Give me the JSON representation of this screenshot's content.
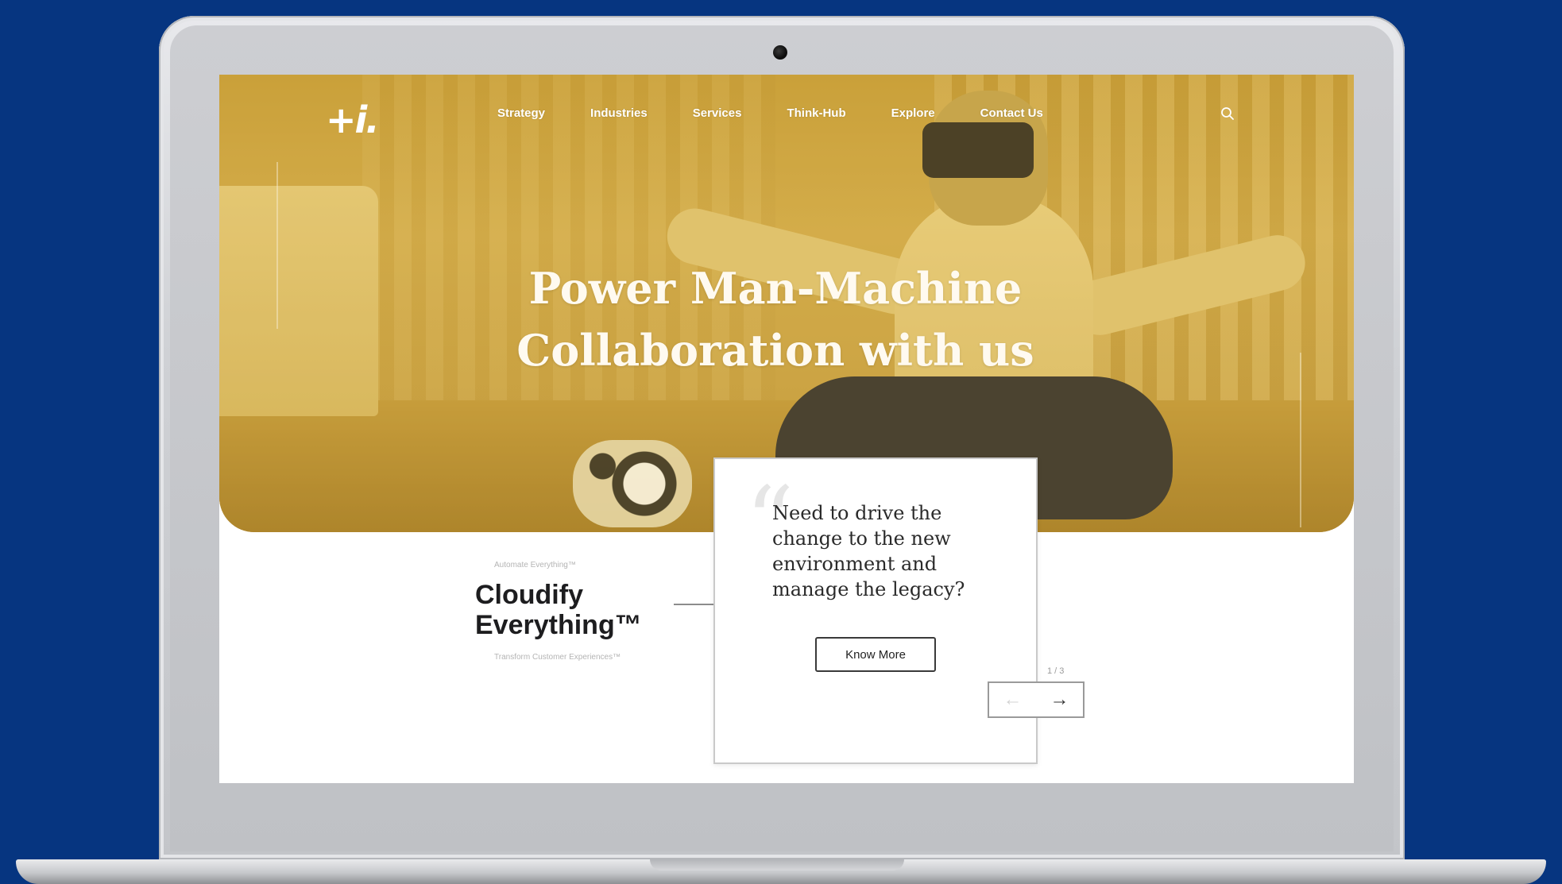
{
  "nav": {
    "logo": "+i.",
    "items": [
      {
        "label": "Strategy"
      },
      {
        "label": "Industries"
      },
      {
        "label": "Services"
      },
      {
        "label": "Think-Hub"
      },
      {
        "label": "Explore"
      },
      {
        "label": "Contact Us"
      }
    ],
    "search_icon": "search-icon"
  },
  "hero": {
    "title": "Power Man-Machine Collaboration with us"
  },
  "section": {
    "tagline_top": "Automate Everything™",
    "heading": "Cloudify\nEverything™",
    "tagline_bottom": "Transform Customer Experiences™"
  },
  "quote_card": {
    "text": "Need to drive the change to the new environment and manage the legacy?",
    "button_label": "Know More"
  },
  "pager": {
    "count": "1 / 3",
    "prev_icon": "arrow-left-icon",
    "next_icon": "arrow-right-icon"
  },
  "colors": {
    "background": "#063580",
    "hero_tint": "#c9a24a",
    "text_dark": "#1d1d1f"
  }
}
